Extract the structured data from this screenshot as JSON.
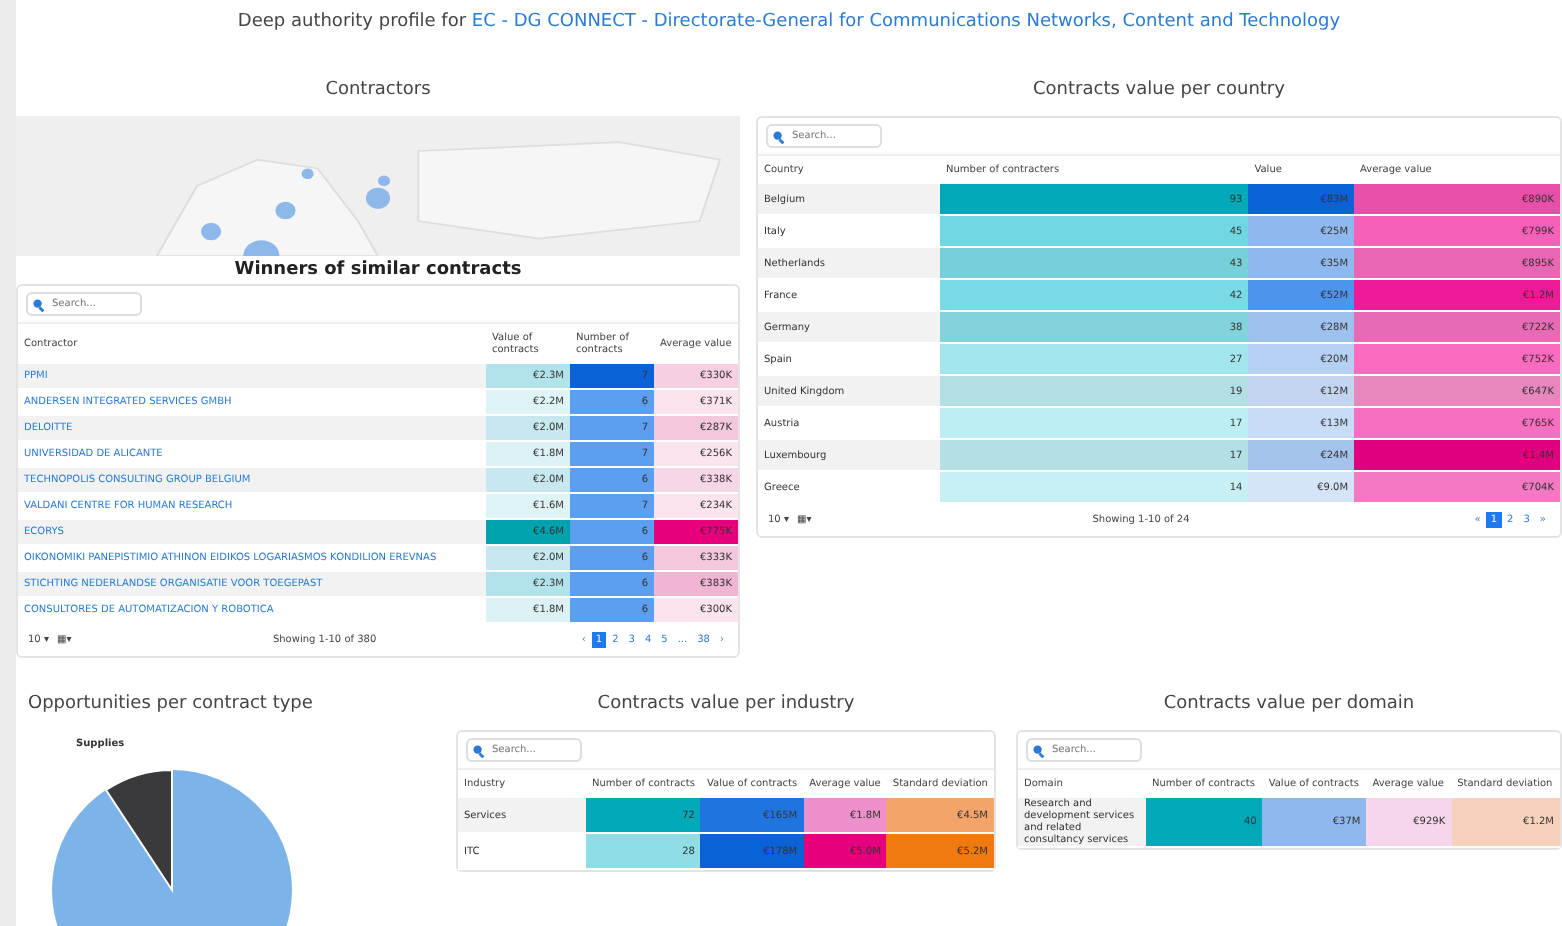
{
  "header": {
    "text": "Deep authority profile for",
    "link": "EC - DG CONNECT - Directorate-General for Communications Networks, Content and Technology"
  },
  "contractors": {
    "title": "Contractors",
    "winners_title": "Winners of similar contracts",
    "search": {
      "placeholder": "Search..."
    },
    "columns": [
      "Contractor",
      "Value of contracts",
      "Number of contracts",
      "Average value"
    ],
    "rows": [
      {
        "cells": [
          {
            "text": "PPMI"
          },
          {
            "text": "€2.3M",
            "color": "#b2e3ea"
          },
          {
            "text": "7",
            "color": "#0b62d6"
          },
          {
            "text": "€330K",
            "color": "#f7cfe3"
          }
        ]
      },
      {
        "cells": [
          {
            "text": "ANDERSEN INTEGRATED SERVICES GMBH"
          },
          {
            "text": "€2.2M",
            "color": "#def4f7"
          },
          {
            "text": "6",
            "color": "#5c9ff0"
          },
          {
            "text": "€371K",
            "color": "#fbe3ef"
          }
        ]
      },
      {
        "cells": [
          {
            "text": "DELOITTE"
          },
          {
            "text": "€2.0M",
            "color": "#c6e8ee"
          },
          {
            "text": "7",
            "color": "#5c9ff0"
          },
          {
            "text": "€287K",
            "color": "#f3c7dc"
          }
        ]
      },
      {
        "cells": [
          {
            "text": "UNIVERSIDAD DE ALICANTE"
          },
          {
            "text": "€1.8M",
            "color": "#dcf2f5"
          },
          {
            "text": "7",
            "color": "#5c9ff0"
          },
          {
            "text": "€256K",
            "color": "#fbe3ef"
          }
        ]
      },
      {
        "cells": [
          {
            "text": "TECHNOPOLIS CONSULTING GROUP BELGIUM"
          },
          {
            "text": "€2.0M",
            "color": "#c6e8ee"
          },
          {
            "text": "6",
            "color": "#5c9ff0"
          },
          {
            "text": "€338K",
            "color": "#f7d7e7"
          }
        ]
      },
      {
        "cells": [
          {
            "text": "VALDANI CENTRE FOR HUMAN RESEARCH"
          },
          {
            "text": "€1.6M",
            "color": "#def4f7"
          },
          {
            "text": "7",
            "color": "#5c9ff0"
          },
          {
            "text": "€234K",
            "color": "#fbe3ef"
          }
        ]
      },
      {
        "cells": [
          {
            "text": "ECORYS"
          },
          {
            "text": "€4.6M",
            "color": "#00a2ad"
          },
          {
            "text": "6",
            "color": "#5c9ff0"
          },
          {
            "text": "€775K",
            "color": "#e6007e"
          }
        ]
      },
      {
        "cells": [
          {
            "text": "OIKONOMIKI PANEPISTIMIO ATHINON EIDIKOS LOGARIASMOS KONDILION EREVNAS"
          },
          {
            "text": "€2.0M",
            "color": "#c6e8ee"
          },
          {
            "text": "6",
            "color": "#5c9ff0"
          },
          {
            "text": "€333K",
            "color": "#f3c7dc"
          }
        ]
      },
      {
        "cells": [
          {
            "text": "STICHTING NEDERLANDSE ORGANISATIE VOOR TOEGEPAST"
          },
          {
            "text": "€2.3M",
            "color": "#b2e3ea"
          },
          {
            "text": "6",
            "color": "#5c9ff0"
          },
          {
            "text": "€383K",
            "color": "#efb5d2"
          }
        ]
      },
      {
        "cells": [
          {
            "text": "CONSULTORES DE AUTOMATIZACION Y ROBOTICA"
          },
          {
            "text": "€1.8M",
            "color": "#dcf2f5"
          },
          {
            "text": "6",
            "color": "#5c9ff0"
          },
          {
            "text": "€300K",
            "color": "#fbe3ef"
          }
        ]
      }
    ],
    "page_size": "10 ▾",
    "columns_toggle": "▦▾",
    "footer": "Showing 1-10 of 380",
    "pages": [
      {
        "label": "‹",
        "selected": false
      },
      {
        "label": "1",
        "selected": true
      },
      {
        "label": "2",
        "selected": false
      },
      {
        "label": "3",
        "selected": false
      },
      {
        "label": "4",
        "selected": false
      },
      {
        "label": "5",
        "selected": false
      },
      {
        "label": "...",
        "selected": false
      },
      {
        "label": "38",
        "selected": false
      },
      {
        "label": "›",
        "selected": false
      }
    ]
  },
  "country": {
    "title": "Contracts value per country",
    "search": {
      "placeholder": "Search..."
    },
    "columns": [
      "Country",
      "Number of contracters",
      "Value",
      "Average value"
    ],
    "rows": [
      {
        "cells": [
          {
            "text": "Belgium"
          },
          {
            "text": "93",
            "color": "#00a9b8"
          },
          {
            "text": "€83M",
            "color": "#0b62d6"
          },
          {
            "text": "€890K",
            "color": "#e84fa9"
          }
        ]
      },
      {
        "cells": [
          {
            "text": "Italy"
          },
          {
            "text": "45",
            "color": "#6fd6e2"
          },
          {
            "text": "€25M",
            "color": "#8fb8ee"
          },
          {
            "text": "€799K",
            "color": "#f560b8"
          }
        ]
      },
      {
        "cells": [
          {
            "text": "Netherlands"
          },
          {
            "text": "43",
            "color": "#77cfd9"
          },
          {
            "text": "€35M",
            "color": "#8fb8ee"
          },
          {
            "text": "€895K",
            "color": "#e966b2"
          }
        ]
      },
      {
        "cells": [
          {
            "text": "France"
          },
          {
            "text": "42",
            "color": "#79d9e4"
          },
          {
            "text": "€52M",
            "color": "#4d94ec"
          },
          {
            "text": "€1.2M",
            "color": "#ee1a98"
          }
        ]
      },
      {
        "cells": [
          {
            "text": "Germany"
          },
          {
            "text": "38",
            "color": "#82d3dc"
          },
          {
            "text": "€28M",
            "color": "#9fc1ee"
          },
          {
            "text": "€722K",
            "color": "#e76ab4"
          }
        ]
      },
      {
        "cells": [
          {
            "text": "Spain"
          },
          {
            "text": "27",
            "color": "#a2e5ec"
          },
          {
            "text": "€20M",
            "color": "#b6d0f4"
          },
          {
            "text": "€752K",
            "color": "#f86bbf"
          }
        ]
      },
      {
        "cells": [
          {
            "text": "United Kingdom"
          },
          {
            "text": "19",
            "color": "#b1dfe4"
          },
          {
            "text": "€12M",
            "color": "#c3d4ee"
          },
          {
            "text": "€647K",
            "color": "#e787be"
          }
        ]
      },
      {
        "cells": [
          {
            "text": "Austria"
          },
          {
            "text": "17",
            "color": "#bdeef3"
          },
          {
            "text": "€13M",
            "color": "#c8dcf7"
          },
          {
            "text": "€765K",
            "color": "#f76fc0"
          }
        ]
      },
      {
        "cells": [
          {
            "text": "Luxembourg"
          },
          {
            "text": "17",
            "color": "#b3e0e5"
          },
          {
            "text": "€24M",
            "color": "#a4c3ea"
          },
          {
            "text": "€1.4M",
            "color": "#e0007f"
          }
        ]
      },
      {
        "cells": [
          {
            "text": "Greece"
          },
          {
            "text": "14",
            "color": "#c8f0f4"
          },
          {
            "text": "€9.0M",
            "color": "#d5e4f8"
          },
          {
            "text": "€704K",
            "color": "#f478c2"
          }
        ]
      }
    ],
    "page_size": "10 ▾",
    "columns_toggle": "▦▾",
    "footer": "Showing 1-10 of 24",
    "pages": [
      {
        "label": "«",
        "selected": false
      },
      {
        "label": "1",
        "selected": true
      },
      {
        "label": "2",
        "selected": false
      },
      {
        "label": "3",
        "selected": false
      },
      {
        "label": "»",
        "selected": false
      }
    ]
  },
  "opportunities": {
    "title": "Opportunities per contract type",
    "slice_label": "Supplies"
  },
  "industry": {
    "title": "Contracts value per industry",
    "search": {
      "placeholder": "Search..."
    },
    "columns": [
      "Industry",
      "Number of contracts",
      "Value of contracts",
      "Average value",
      "Standard deviation"
    ],
    "rows": [
      {
        "cells": [
          {
            "text": "Services"
          },
          {
            "text": "72",
            "color": "#00a9b8"
          },
          {
            "text": "€165M",
            "color": "#1f74e0"
          },
          {
            "text": "€1.8M",
            "color": "#ec8fcb"
          },
          {
            "text": "€4.5M",
            "color": "#f2a46a"
          }
        ]
      },
      {
        "cells": [
          {
            "text": "ITC"
          },
          {
            "text": "28",
            "color": "#8fdde6"
          },
          {
            "text": "€178M",
            "color": "#0b62d6"
          },
          {
            "text": "€5.0M",
            "color": "#e6007e"
          },
          {
            "text": "€5.2M",
            "color": "#f07a10"
          }
        ]
      }
    ]
  },
  "domain": {
    "title": "Contracts value per domain",
    "search": {
      "placeholder": "Search..."
    },
    "columns": [
      "Domain",
      "Number of contracts",
      "Value of contracts",
      "Average value",
      "Standard deviation"
    ],
    "rows": [
      {
        "cells": [
          {
            "text": "Research and development services and related consultancy services"
          },
          {
            "text": "40",
            "color": "#00a9b8"
          },
          {
            "text": "€37M",
            "color": "#8fb8ee"
          },
          {
            "text": "€929K",
            "color": "#f6d6ea"
          },
          {
            "text": "€1.2M",
            "color": "#f6d2bd"
          }
        ]
      }
    ]
  }
}
